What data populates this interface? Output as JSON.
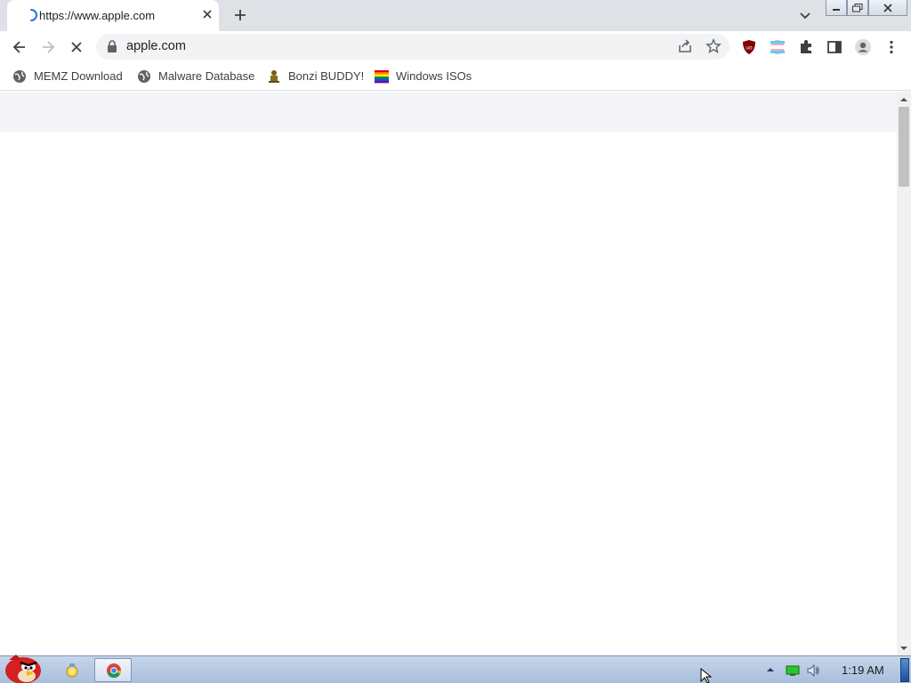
{
  "tabstrip": {
    "tab_title": "https://www.apple.com",
    "icons": [
      "loading-spinner-icon",
      "close-icon",
      "plus-icon",
      "chevron-down-icon"
    ]
  },
  "window_controls": [
    "minimize-icon",
    "restore-icon",
    "close-icon"
  ],
  "toolbar": {
    "url": "apple.com",
    "icons": [
      "back-arrow-icon",
      "forward-arrow-icon",
      "stop-loading-icon",
      "lock-icon",
      "share-icon",
      "star-icon",
      "ublock-icon",
      "extension-flag-icon",
      "puzzle-icon",
      "side-panel-icon",
      "profile-icon",
      "more-vert-icon"
    ]
  },
  "bookmarks": [
    {
      "label": "MEMZ Download",
      "icon": "globe-icon"
    },
    {
      "label": "Malware Database",
      "icon": "globe-icon"
    },
    {
      "label": "Bonzi BUDDY!",
      "icon": "bonzi-icon"
    },
    {
      "label": "Windows ISOs",
      "icon": "rainbow-flag-icon"
    }
  ],
  "page": {
    "band_color": "#f5f5f7"
  },
  "taskbar": {
    "start_icon": "angry-bird-start-icon",
    "apps": [
      "explorer-icon",
      "chrome-icon"
    ],
    "tray_icons": [
      "tray-expand-icon",
      "network-icon",
      "volume-icon"
    ],
    "clock": "1:19 AM"
  }
}
